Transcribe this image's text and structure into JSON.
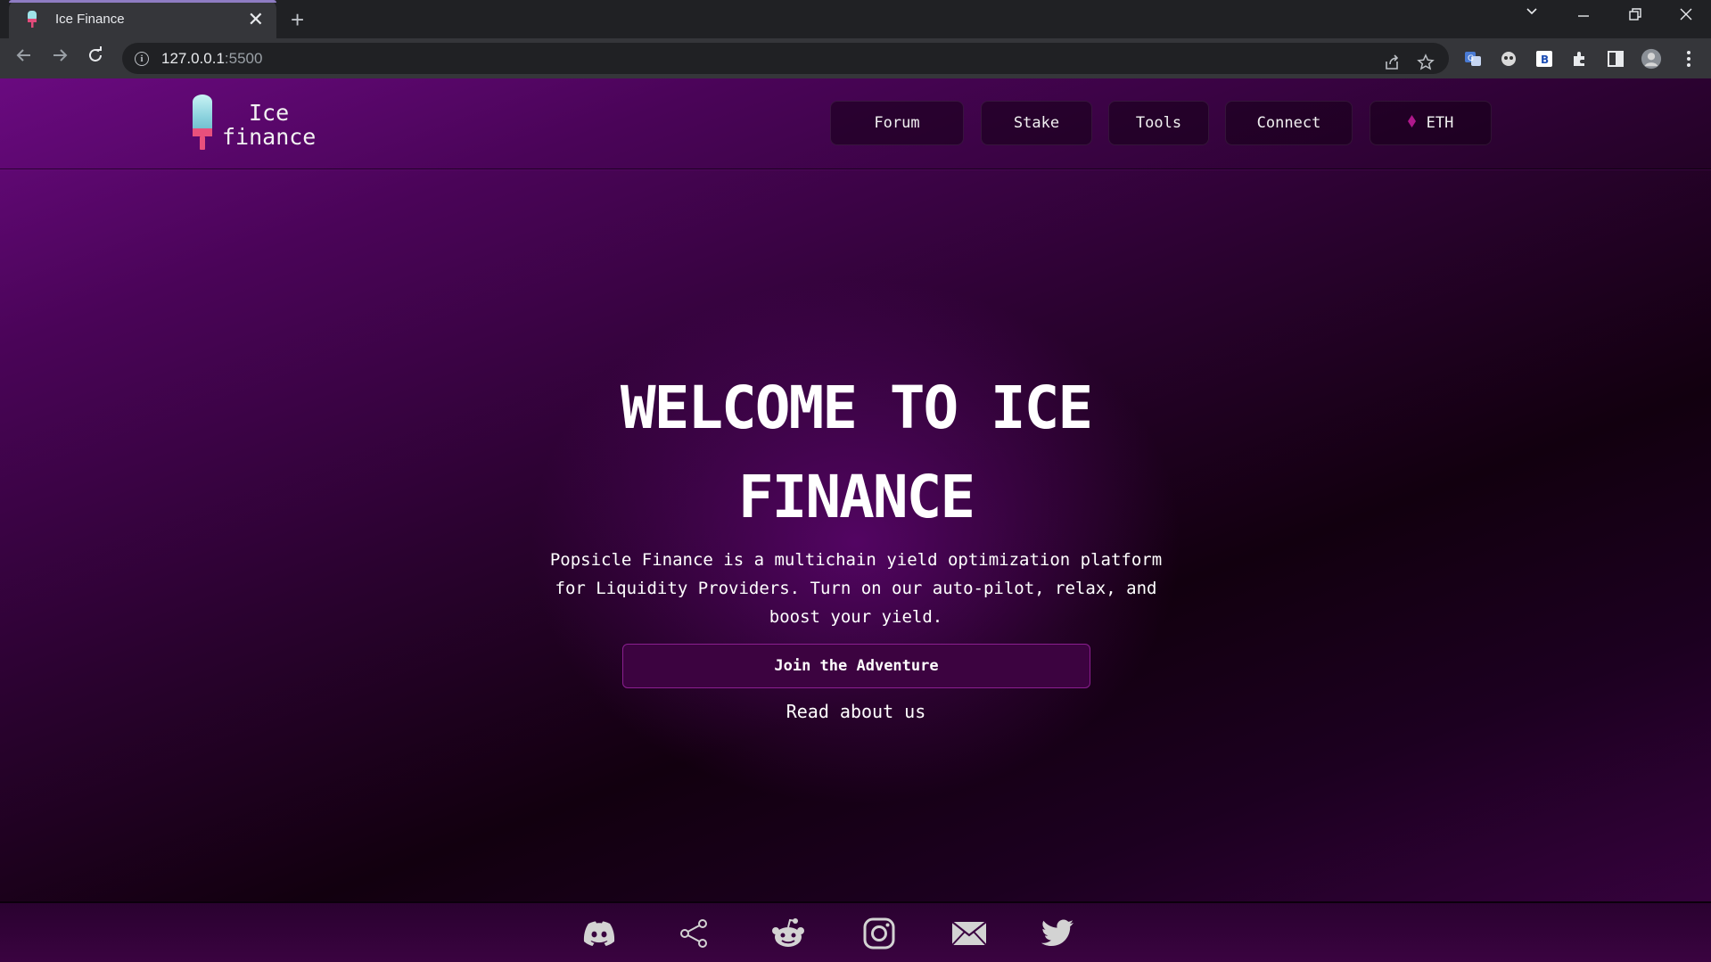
{
  "browser": {
    "tab_title": "Ice Finance",
    "new_tab_symbol": "+",
    "close_symbol": "✕",
    "url_host": "127.0.0.1",
    "url_port": ":5500",
    "icons": [
      "back-arrow-icon",
      "forward-arrow-icon",
      "reload-icon",
      "info-icon",
      "share-icon",
      "star-icon",
      "translate-icon",
      "extensions-icon",
      "side-panel-icon",
      "profile-avatar",
      "menu-icon"
    ]
  },
  "header": {
    "logo_line1": "Ice",
    "logo_line2": "finance",
    "nav": [
      {
        "label": "Forum"
      },
      {
        "label": "Stake"
      },
      {
        "label": "Tools"
      },
      {
        "label": "Connect"
      },
      {
        "label": "ETH"
      }
    ]
  },
  "hero": {
    "title_line1": "WELCOME TO ICE",
    "title_line2": "FINANCE",
    "description": "Popsicle Finance is a multichain yield optimization platform for Liquidity Providers. Turn on our auto-pilot, relax, and boost your yield.",
    "cta_label": "Join the Adventure",
    "link_label": "Read about us"
  },
  "footer": {
    "social_icons": [
      "discord-icon",
      "share-icon",
      "reddit-icon",
      "instagram-icon",
      "mail-icon",
      "twitter-icon"
    ]
  },
  "colors": {
    "accent": "#8a1f8f",
    "button_bg": "#3c0340",
    "eth_diamond": "#b0188c",
    "footer_icon": "#d3d3d3"
  }
}
